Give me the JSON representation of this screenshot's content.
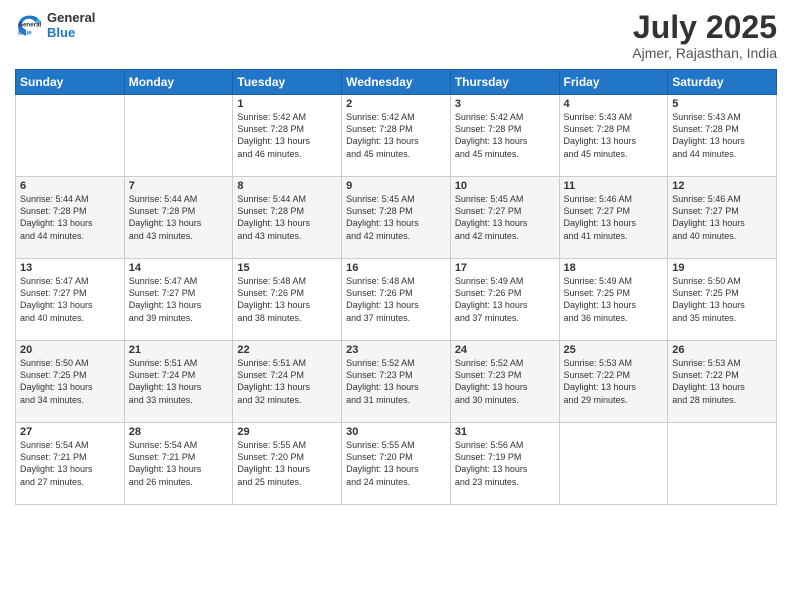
{
  "header": {
    "logo_general": "General",
    "logo_blue": "Blue",
    "month_year": "July 2025",
    "location": "Ajmer, Rajasthan, India"
  },
  "calendar": {
    "headers": [
      "Sunday",
      "Monday",
      "Tuesday",
      "Wednesday",
      "Thursday",
      "Friday",
      "Saturday"
    ],
    "weeks": [
      [
        {
          "day": "",
          "info": ""
        },
        {
          "day": "",
          "info": ""
        },
        {
          "day": "1",
          "info": "Sunrise: 5:42 AM\nSunset: 7:28 PM\nDaylight: 13 hours\nand 46 minutes."
        },
        {
          "day": "2",
          "info": "Sunrise: 5:42 AM\nSunset: 7:28 PM\nDaylight: 13 hours\nand 45 minutes."
        },
        {
          "day": "3",
          "info": "Sunrise: 5:42 AM\nSunset: 7:28 PM\nDaylight: 13 hours\nand 45 minutes."
        },
        {
          "day": "4",
          "info": "Sunrise: 5:43 AM\nSunset: 7:28 PM\nDaylight: 13 hours\nand 45 minutes."
        },
        {
          "day": "5",
          "info": "Sunrise: 5:43 AM\nSunset: 7:28 PM\nDaylight: 13 hours\nand 44 minutes."
        }
      ],
      [
        {
          "day": "6",
          "info": "Sunrise: 5:44 AM\nSunset: 7:28 PM\nDaylight: 13 hours\nand 44 minutes."
        },
        {
          "day": "7",
          "info": "Sunrise: 5:44 AM\nSunset: 7:28 PM\nDaylight: 13 hours\nand 43 minutes."
        },
        {
          "day": "8",
          "info": "Sunrise: 5:44 AM\nSunset: 7:28 PM\nDaylight: 13 hours\nand 43 minutes."
        },
        {
          "day": "9",
          "info": "Sunrise: 5:45 AM\nSunset: 7:28 PM\nDaylight: 13 hours\nand 42 minutes."
        },
        {
          "day": "10",
          "info": "Sunrise: 5:45 AM\nSunset: 7:27 PM\nDaylight: 13 hours\nand 42 minutes."
        },
        {
          "day": "11",
          "info": "Sunrise: 5:46 AM\nSunset: 7:27 PM\nDaylight: 13 hours\nand 41 minutes."
        },
        {
          "day": "12",
          "info": "Sunrise: 5:46 AM\nSunset: 7:27 PM\nDaylight: 13 hours\nand 40 minutes."
        }
      ],
      [
        {
          "day": "13",
          "info": "Sunrise: 5:47 AM\nSunset: 7:27 PM\nDaylight: 13 hours\nand 40 minutes."
        },
        {
          "day": "14",
          "info": "Sunrise: 5:47 AM\nSunset: 7:27 PM\nDaylight: 13 hours\nand 39 minutes."
        },
        {
          "day": "15",
          "info": "Sunrise: 5:48 AM\nSunset: 7:26 PM\nDaylight: 13 hours\nand 38 minutes."
        },
        {
          "day": "16",
          "info": "Sunrise: 5:48 AM\nSunset: 7:26 PM\nDaylight: 13 hours\nand 37 minutes."
        },
        {
          "day": "17",
          "info": "Sunrise: 5:49 AM\nSunset: 7:26 PM\nDaylight: 13 hours\nand 37 minutes."
        },
        {
          "day": "18",
          "info": "Sunrise: 5:49 AM\nSunset: 7:25 PM\nDaylight: 13 hours\nand 36 minutes."
        },
        {
          "day": "19",
          "info": "Sunrise: 5:50 AM\nSunset: 7:25 PM\nDaylight: 13 hours\nand 35 minutes."
        }
      ],
      [
        {
          "day": "20",
          "info": "Sunrise: 5:50 AM\nSunset: 7:25 PM\nDaylight: 13 hours\nand 34 minutes."
        },
        {
          "day": "21",
          "info": "Sunrise: 5:51 AM\nSunset: 7:24 PM\nDaylight: 13 hours\nand 33 minutes."
        },
        {
          "day": "22",
          "info": "Sunrise: 5:51 AM\nSunset: 7:24 PM\nDaylight: 13 hours\nand 32 minutes."
        },
        {
          "day": "23",
          "info": "Sunrise: 5:52 AM\nSunset: 7:23 PM\nDaylight: 13 hours\nand 31 minutes."
        },
        {
          "day": "24",
          "info": "Sunrise: 5:52 AM\nSunset: 7:23 PM\nDaylight: 13 hours\nand 30 minutes."
        },
        {
          "day": "25",
          "info": "Sunrise: 5:53 AM\nSunset: 7:22 PM\nDaylight: 13 hours\nand 29 minutes."
        },
        {
          "day": "26",
          "info": "Sunrise: 5:53 AM\nSunset: 7:22 PM\nDaylight: 13 hours\nand 28 minutes."
        }
      ],
      [
        {
          "day": "27",
          "info": "Sunrise: 5:54 AM\nSunset: 7:21 PM\nDaylight: 13 hours\nand 27 minutes."
        },
        {
          "day": "28",
          "info": "Sunrise: 5:54 AM\nSunset: 7:21 PM\nDaylight: 13 hours\nand 26 minutes."
        },
        {
          "day": "29",
          "info": "Sunrise: 5:55 AM\nSunset: 7:20 PM\nDaylight: 13 hours\nand 25 minutes."
        },
        {
          "day": "30",
          "info": "Sunrise: 5:55 AM\nSunset: 7:20 PM\nDaylight: 13 hours\nand 24 minutes."
        },
        {
          "day": "31",
          "info": "Sunrise: 5:56 AM\nSunset: 7:19 PM\nDaylight: 13 hours\nand 23 minutes."
        },
        {
          "day": "",
          "info": ""
        },
        {
          "day": "",
          "info": ""
        }
      ]
    ]
  }
}
